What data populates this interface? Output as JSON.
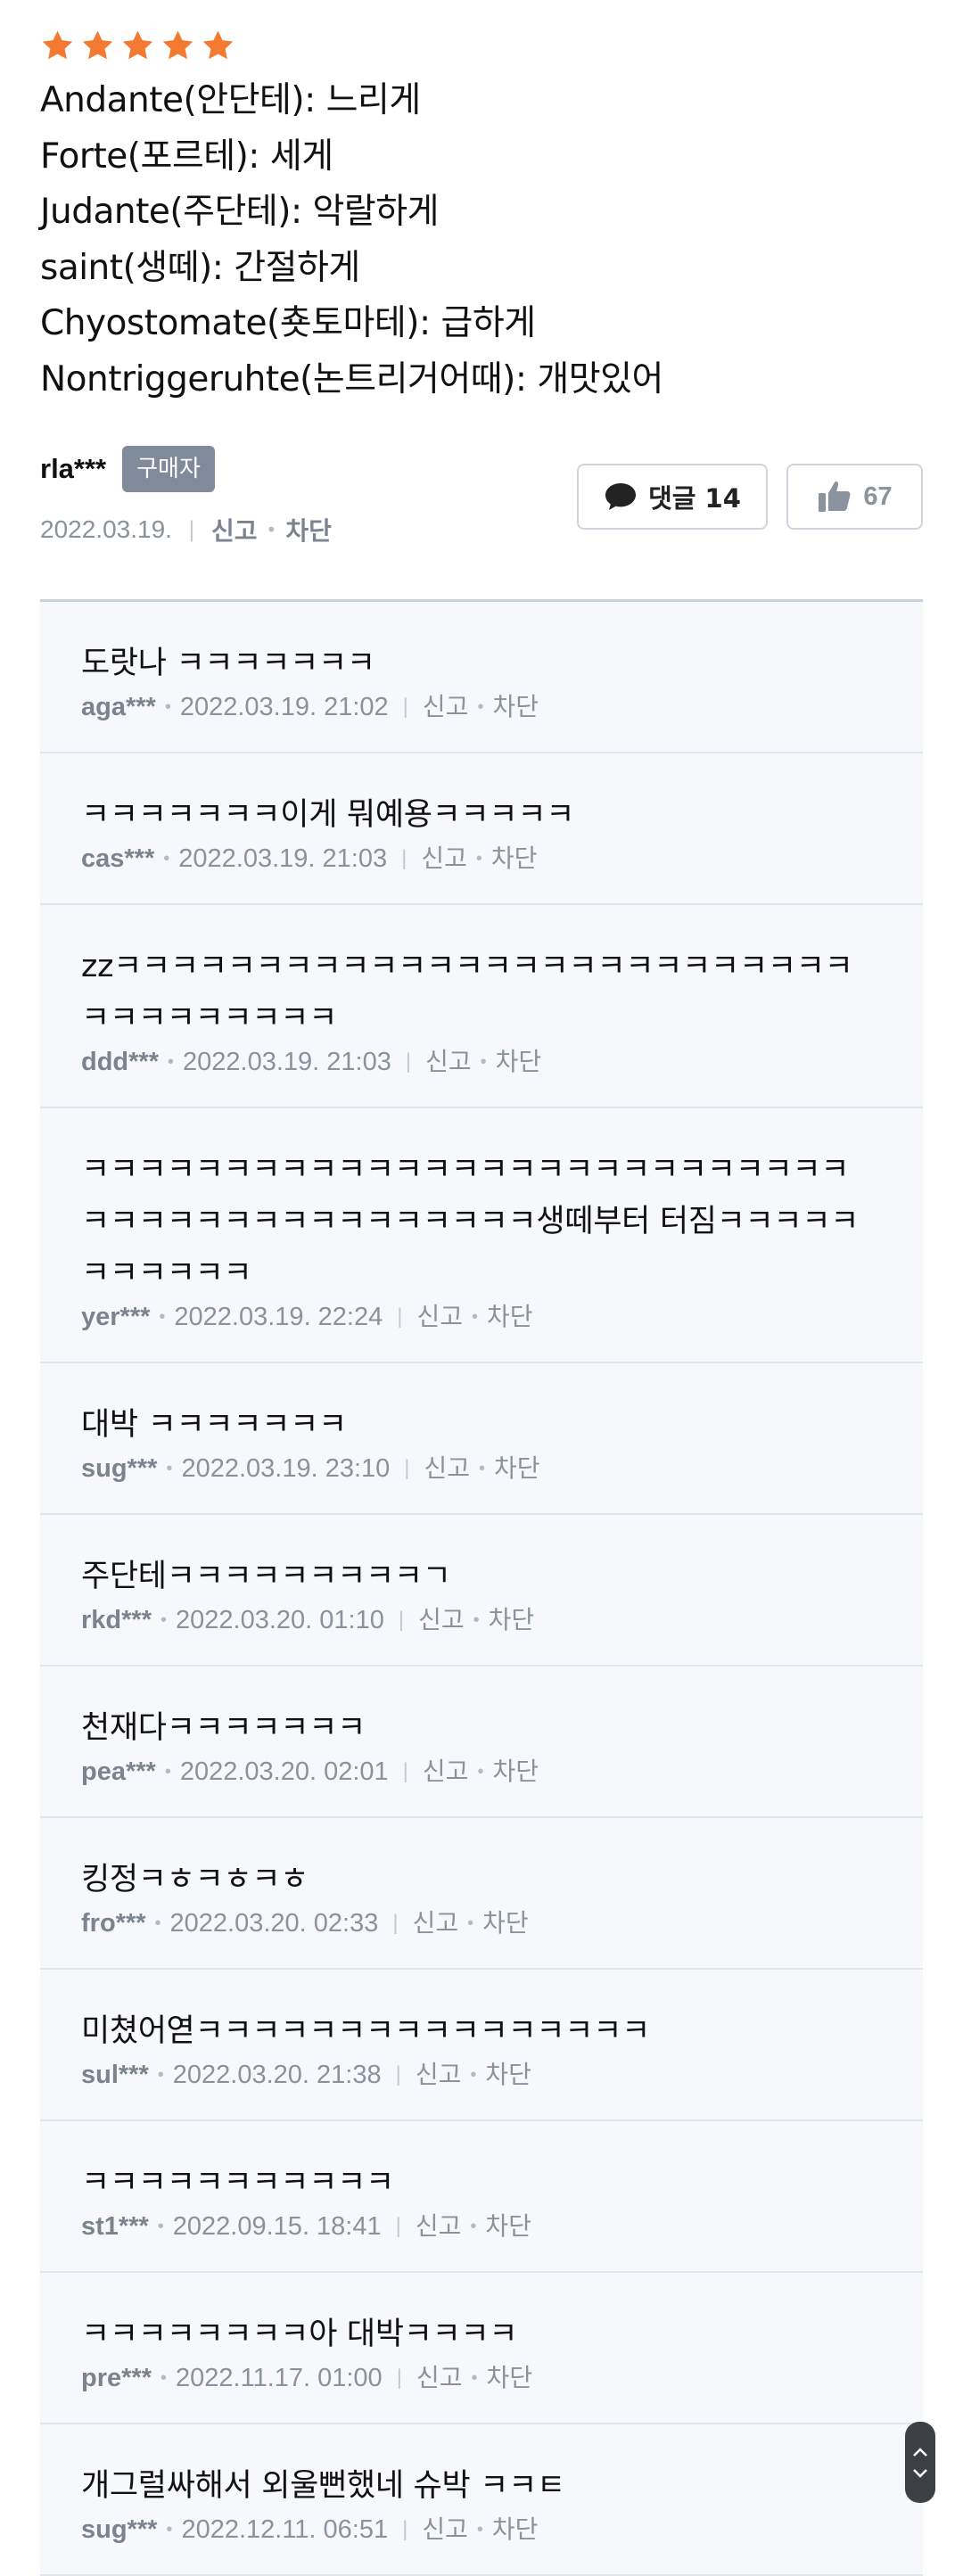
{
  "review": {
    "rating": 5,
    "star_color": "#f47a32",
    "lines": [
      "Andante(안단테): 느리게",
      "Forte(포르테): 세게",
      "Judante(주단테): 악랄하게",
      "saint(생떼): 간절하게",
      "Chyostomate(춋토마테): 급하게",
      "Nontriggeruhte(논트리거어때): 개맛있어"
    ],
    "author": "rla***",
    "badge": "구매자",
    "date": "2022.03.19.",
    "report_label": "신고",
    "block_label": "차단",
    "comment_button_label": "댓글 14",
    "like_count": "67"
  },
  "comments": [
    {
      "text": "도랏나 ㅋㅋㅋㅋㅋㅋㅋ",
      "user": "aga***",
      "time": "2022.03.19. 21:02",
      "report": "신고",
      "block": "차단"
    },
    {
      "text": "ㅋㅋㅋㅋㅋㅋㅋ이게 뭐예용ㅋㅋㅋㅋㅋ",
      "user": "cas***",
      "time": "2022.03.19. 21:03",
      "report": "신고",
      "block": "차단"
    },
    {
      "text": "zzㅋㅋㅋㅋㅋㅋㅋㅋㅋㅋㅋㅋㅋㅋㅋㅋㅋㅋㅋㅋㅋㅋㅋㅋㅋㅋㅋㅋㅋㅋㅋㅋㅋㅋㅋ",
      "user": "ddd***",
      "time": "2022.03.19. 21:03",
      "report": "신고",
      "block": "차단"
    },
    {
      "text": "ㅋㅋㅋㅋㅋㅋㅋㅋㅋㅋㅋㅋㅋㅋㅋㅋㅋㅋㅋㅋㅋㅋㅋㅋㅋㅋㅋㅋㅋㅋㅋㅋㅋㅋㅋㅋㅋㅋㅋㅋㅋㅋㅋ생떼부터 터짐ㅋㅋㅋㅋㅋㅋㅋㅋㅋㅋㅋ",
      "user": "yer***",
      "time": "2022.03.19. 22:24",
      "report": "신고",
      "block": "차단"
    },
    {
      "text": "대박 ㅋㅋㅋㅋㅋㅋㅋ",
      "user": "sug***",
      "time": "2022.03.19. 23:10",
      "report": "신고",
      "block": "차단"
    },
    {
      "text": "주단테ㅋㅋㅋㅋㅋㅋㅋㅋㅋㄱ",
      "user": "rkd***",
      "time": "2022.03.20. 01:10",
      "report": "신고",
      "block": "차단"
    },
    {
      "text": "천재다ㅋㅋㅋㅋㅋㅋㅋ",
      "user": "pea***",
      "time": "2022.03.20. 02:01",
      "report": "신고",
      "block": "차단"
    },
    {
      "text": "킹정ㅋㅎㅋㅎㅋㅎ",
      "user": "fro***",
      "time": "2022.03.20. 02:33",
      "report": "신고",
      "block": "차단"
    },
    {
      "text": "미쳤어엳ㅋㅋㅋㅋㅋㅋㅋㅋㅋㅋㅋㅋㅋㅋㅋㅋ",
      "user": "sul***",
      "time": "2022.03.20. 21:38",
      "report": "신고",
      "block": "차단"
    },
    {
      "text": "ㅋㅋㅋㅋㅋㅋㅋㅋㅋㅋㅋ",
      "user": "st1***",
      "time": "2022.09.15. 18:41",
      "report": "신고",
      "block": "차단"
    },
    {
      "text": "ㅋㅋㅋㅋㅋㅋㅋㅋ아 대박ㅋㅋㅋㅋ",
      "user": "pre***",
      "time": "2022.11.17. 01:00",
      "report": "신고",
      "block": "차단"
    },
    {
      "text": "개그럴싸해서 외울뻔했네 슈박 ㅋㅋㅌ",
      "user": "sug***",
      "time": "2022.12.11. 06:51",
      "report": "신고",
      "block": "차단"
    }
  ]
}
